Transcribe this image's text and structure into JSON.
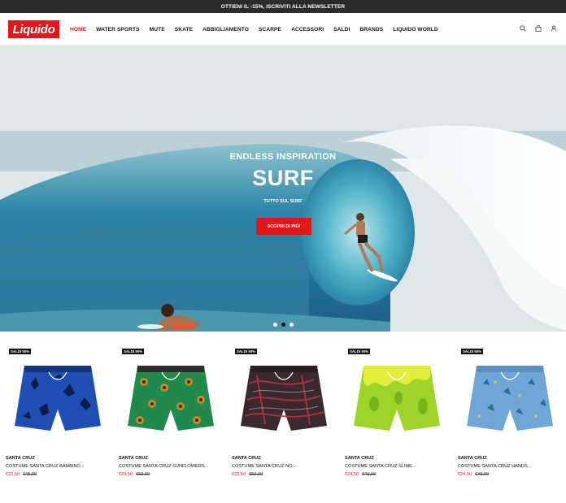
{
  "topbar": {
    "text": "OTTIENI IL -15%, ISCRIVITI ALLA NEWSLETTER"
  },
  "header": {
    "logo": "Liquido",
    "nav": [
      "HOME",
      "WATER SPORTS",
      "MUTE",
      "SKATE",
      "ABBIGLIAMENTO",
      "SCARPE",
      "ACCESSORI",
      "SALDI",
      "BRANDS",
      "LIQUIDO WORLD"
    ],
    "active_index": 0,
    "icons": [
      "search-icon",
      "bag-icon",
      "user-icon"
    ]
  },
  "hero": {
    "subtitle": "ENDLESS INSPIRATION",
    "title": "SURF",
    "caption": "TUTTO SUL SURF",
    "button": "SCOPRI DI PIÙ!",
    "slides": 3,
    "active_slide": 1
  },
  "products": [
    {
      "badge": "SALDI 50%",
      "brand": "SANTA CRUZ",
      "name": "COSTUME SANTA CRUZ BAMBINO...",
      "price": "€22,50",
      "old_price": "€45,00",
      "color": "#1f4fb4",
      "pattern_color": "#0b1e4a"
    },
    {
      "badge": "SALDI 50%",
      "brand": "SANTA CRUZ",
      "name": "COSTUME SANTA CRUZ SUNFLOWERS...",
      "price": "€29,50",
      "old_price": "€59,00",
      "color": "#1f8a4c",
      "pattern_color": "#c88a1e"
    },
    {
      "badge": "SALDI 50%",
      "brand": "SANTA CRUZ",
      "name": "COSTUME SANTA CRUZ NO...",
      "price": "€29,50",
      "old_price": "€59,00",
      "color": "#3a2a30",
      "pattern_color": "#b0353d"
    },
    {
      "badge": "SALDI 50%",
      "brand": "SANTA CRUZ",
      "name": "COSTUME SANTA CRUZ SLIME...",
      "price": "€24,50",
      "old_price": "€49,00",
      "color": "#9ed42a",
      "pattern_color": "#e2ee3a"
    },
    {
      "badge": "SALDI 50%",
      "brand": "SANTA CRUZ",
      "name": "COSTUME SANTA CRUZ HANDS...",
      "price": "€24,50",
      "old_price": "€49,00",
      "color": "#6fa6d8",
      "pattern_color": "#2c6e8f"
    }
  ],
  "colors": {
    "brand_red": "#e3171a",
    "topbar": "#2b2b2b"
  }
}
